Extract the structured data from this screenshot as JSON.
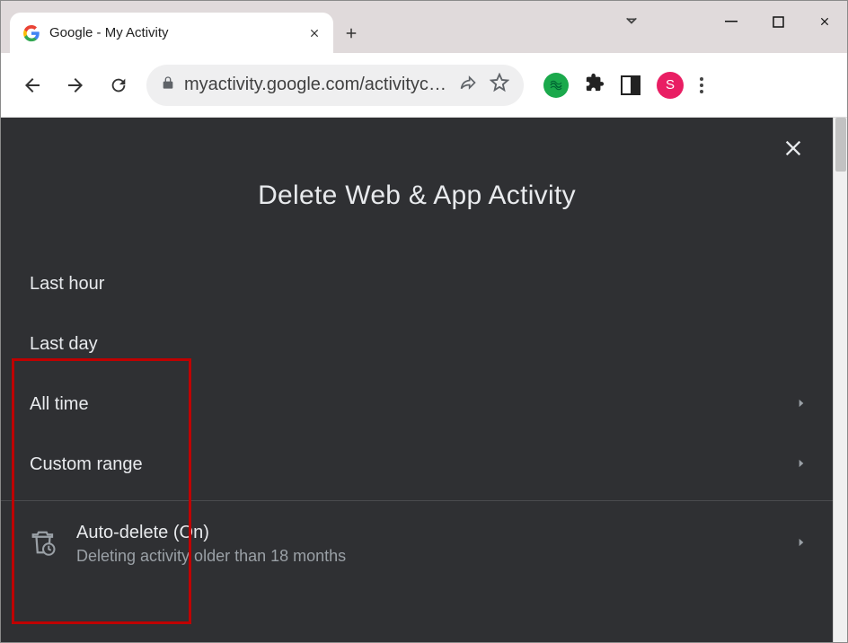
{
  "tab": {
    "title": "Google - My Activity"
  },
  "omnibox": {
    "url": "myactivity.google.com/activitycon…"
  },
  "avatar": {
    "initial": "S"
  },
  "dialog": {
    "title": "Delete Web & App Activity",
    "options": [
      {
        "label": "Last hour",
        "has_chevron": false
      },
      {
        "label": "Last day",
        "has_chevron": false
      },
      {
        "label": "All time",
        "has_chevron": true
      },
      {
        "label": "Custom range",
        "has_chevron": true
      }
    ],
    "auto_delete": {
      "title": "Auto-delete (On)",
      "subtitle": "Deleting activity older than 18 months"
    }
  }
}
